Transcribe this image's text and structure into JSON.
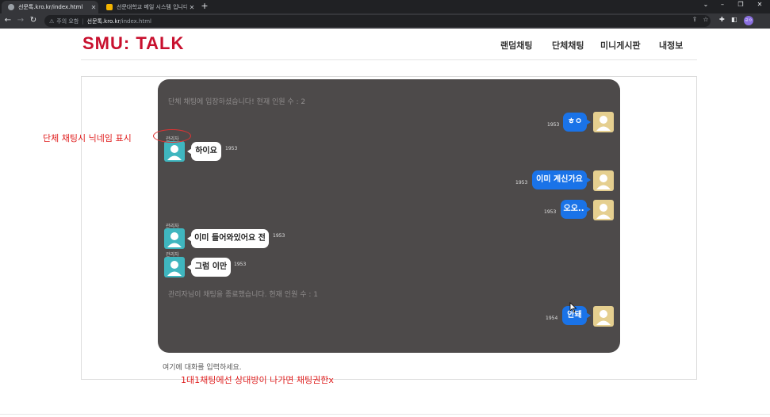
{
  "browser": {
    "tabs": [
      {
        "title": "선문톡.kro.kr/index.html",
        "active": true
      },
      {
        "title": "선문대학교 메일 시스템 입니다.",
        "active": false
      }
    ],
    "new_tab": "+",
    "security_label": "주의 요함",
    "address_host": "선문톡.kro.kr",
    "address_path": "/index.html",
    "profile_initials": "ㄹㅇ"
  },
  "site": {
    "logo": "SMU: TALK",
    "nav": [
      "랜덤채팅",
      "단체채팅",
      "미니게시판",
      "내정보"
    ]
  },
  "chat": {
    "system_messages": [
      "단체 채팅에 입장하셨습니다! 현재 인원 수 : 2",
      "관리자님이 채팅을 종료했습니다. 현재 인원 수 : 1"
    ],
    "messages": [
      {
        "side": "me",
        "text": "ㅎㅇ",
        "time": "1953"
      },
      {
        "side": "other",
        "nick": "관리자",
        "text": "하이요",
        "time": "1953"
      },
      {
        "side": "me",
        "text": "이미 계신가요",
        "time": "1953"
      },
      {
        "side": "me",
        "text": "오오..",
        "time": "1953"
      },
      {
        "side": "other",
        "nick": "관리자",
        "text": "이미 들어와있어요 전",
        "time": "1953"
      },
      {
        "side": "other",
        "nick": "관리자",
        "text": "그럼 이만",
        "time": "1953"
      },
      {
        "side": "me",
        "text": "안돼",
        "time": "1954"
      }
    ],
    "input_placeholder": "여기에 대화를 입력하세요."
  },
  "annotations": {
    "nickname_note": "단체 채팅시 닉네임 표시",
    "one_to_one_note": "1대1채팅에선 상대방이 나가면 채팅권한x"
  },
  "colors": {
    "brand": "#c8102e",
    "chat_bg": "#4d4a4a",
    "my_bubble": "#1a73e8",
    "annotation": "#e02020"
  }
}
